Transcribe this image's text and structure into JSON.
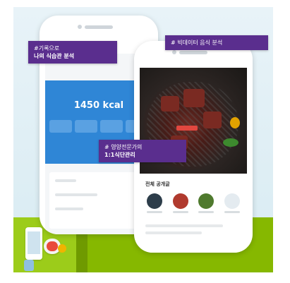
{
  "colors": {
    "accent_blue": "#2f86d6",
    "tag_purple": "#5a2e8e",
    "brand_green": "#86b800",
    "highlight_red": "#e2473f"
  },
  "tags": {
    "tag1_line1": "#기록으로",
    "tag1_line2": "나의 식습관 분석",
    "tag2": "# 빅데이터 음식 분석",
    "tag3_line1": "# 영양전문가의",
    "tag3_line2": "1:1식단관리"
  },
  "back_phone": {
    "kcal_value": "1450 kcal"
  },
  "front_phone": {
    "section_title": "전체 공개글"
  }
}
